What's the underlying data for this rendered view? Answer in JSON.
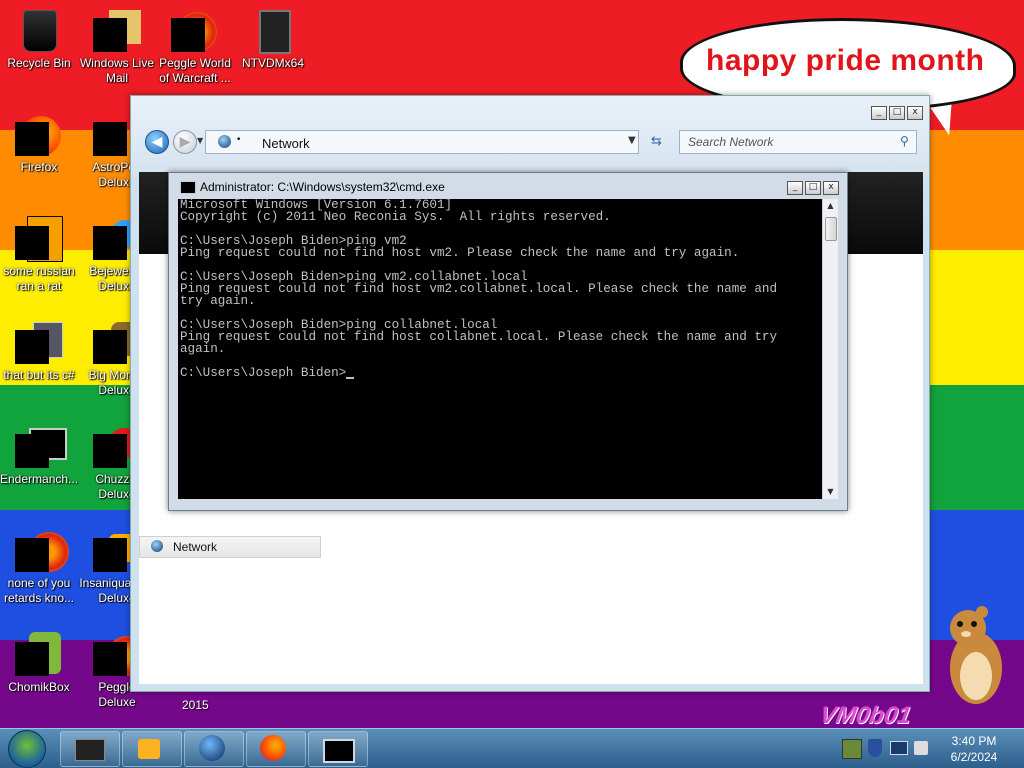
{
  "desktop": {
    "icons": [
      {
        "label": "Recycle Bin",
        "icon": "recycle-bin-icon"
      },
      {
        "label": "Windows Live Mail",
        "icon": "mail-icon"
      },
      {
        "label": "Peggle World of Warcraft ...",
        "icon": "peggle-icon"
      },
      {
        "label": "NTVDMx64",
        "icon": "ntvdm-icon"
      },
      {
        "label": "Firefox",
        "icon": "firefox-icon"
      },
      {
        "label": "AstroPop Deluxe",
        "icon": "astropop-icon"
      },
      {
        "label": "some russian ran a rat",
        "icon": "exe-icon"
      },
      {
        "label": "Bejeweled Deluxe",
        "icon": "bejeweled-icon"
      },
      {
        "label": "that but its c#",
        "icon": "csharp-icon"
      },
      {
        "label": "Big Money Deluxe",
        "icon": "bigmoney-icon"
      },
      {
        "label": "Endermanch...",
        "icon": "enderman-icon"
      },
      {
        "label": "Chuzzle Deluxe",
        "icon": "chuzzle-icon"
      },
      {
        "label": "none of you retards kno...",
        "icon": "peggle-icon"
      },
      {
        "label": "Insaniquarium Deluxe",
        "icon": "insaniquarium-icon"
      },
      {
        "label": "ChomikBox",
        "icon": "chomikbox-icon"
      },
      {
        "label": "Peggle Deluxe",
        "icon": "peggle-icon"
      }
    ],
    "speech_bubble": "happy pride month",
    "extra_text": "2015",
    "wallpaper_text": "VM0b01",
    "colors": {
      "red": "#ee1c24",
      "orange": "#ff8c00",
      "yellow": "#ffed00",
      "green": "#11a33c",
      "blue": "#1f4fe0",
      "purple": "#75088a",
      "bubble_text": "#e2141b"
    }
  },
  "explorer": {
    "title": "",
    "address": "Network",
    "search_placeholder": "Search Network",
    "left_nav_item": "Network",
    "window_controls": [
      "minimize",
      "maximize",
      "close"
    ]
  },
  "cmd": {
    "title": "Administrator: C:\\Windows\\system32\\cmd.exe",
    "lines": [
      "Microsoft Windows [Version 6.1.7601]",
      "Copyright (c) 2011 Neo Reconia Sys.  All rights reserved.",
      "",
      "C:\\Users\\Joseph Biden>ping vm2",
      "Ping request could not find host vm2. Please check the name and try again.",
      "",
      "C:\\Users\\Joseph Biden>ping vm2.collabnet.local",
      "Ping request could not find host vm2.collabnet.local. Please check the name and",
      "try again.",
      "",
      "C:\\Users\\Joseph Biden>ping collabnet.local",
      "Ping request could not find host collabnet.local. Please check the name and try",
      "again.",
      "",
      "C:\\Users\\Joseph Biden>"
    ]
  },
  "taskbar": {
    "items": [
      "explorer-icon",
      "media-player-icon",
      "network-icon",
      "firefox-icon",
      "cmd-icon"
    ],
    "time": "3:40 PM",
    "date": "6/2/2024"
  }
}
